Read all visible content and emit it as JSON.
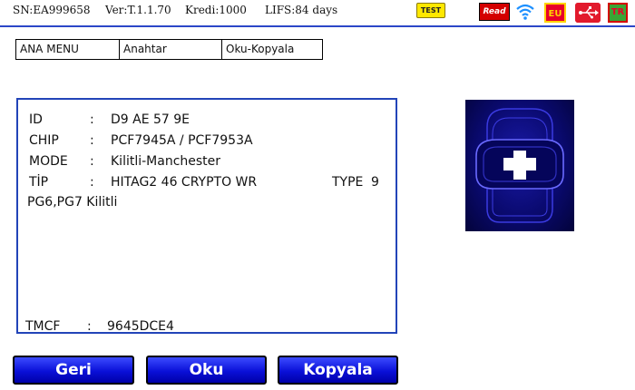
{
  "status": {
    "sn": "SN:EA999658",
    "version": "Ver:T.1.1.70",
    "kredi": "Kredi:1000",
    "lifs": "LIFS:84 days",
    "test_badge": "TEST",
    "icons": [
      "read-icon",
      "wifi-icon",
      "eu-flag-icon",
      "usb-icon",
      "tr-flag-icon"
    ]
  },
  "breadcrumb": [
    "ANA MENU",
    "Anahtar",
    "Oku-Kopyala"
  ],
  "info": {
    "rows": [
      {
        "key": "ID",
        "value": "D9 AE 57 9E"
      },
      {
        "key": "CHIP",
        "value": "PCF7945A / PCF7953A"
      },
      {
        "key": "MODE",
        "value": "Kilitli-Manchester"
      },
      {
        "key": "TİP",
        "value": "HITAG2 46 CRYPTO WR"
      }
    ],
    "separator": ":",
    "type_label": "TYPE",
    "type_value": "9",
    "note": "PG6,PG7 Kilitli",
    "tmcf_label": "TMCF",
    "tmcf_value": "9645DCE4"
  },
  "buttons": {
    "back": "Geri",
    "read": "Oku",
    "copy": "Kopyala"
  },
  "colors": {
    "accent": "#2b47c8",
    "button": "#0a10d8",
    "panel_border": "#2244b8"
  }
}
